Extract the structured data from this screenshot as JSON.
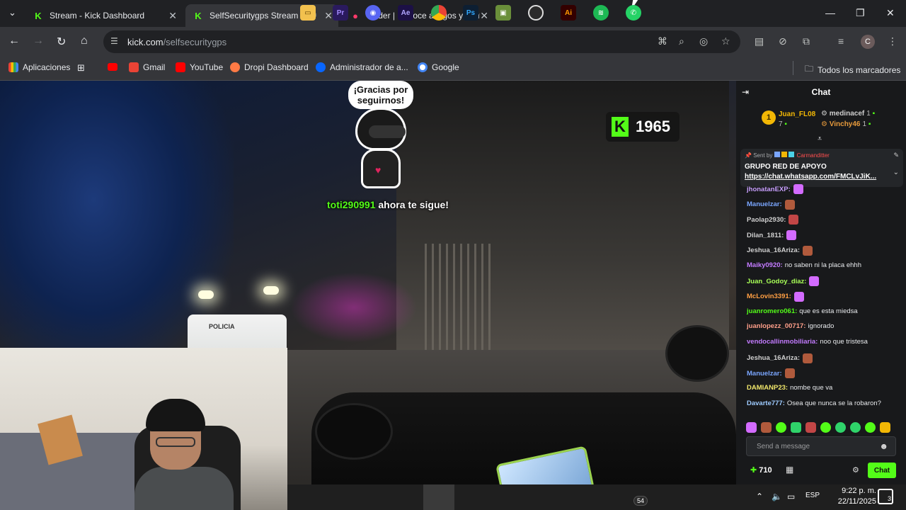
{
  "tabs": [
    {
      "title": "Stream - Kick Dashboard",
      "icon": "kick-icon"
    },
    {
      "title": "SelfSecuritygps Stream - W",
      "icon": "kick-icon",
      "audio": true
    },
    {
      "title": "Tinder | Conoce amigos y gente",
      "icon": "tinder-icon"
    }
  ],
  "address": {
    "host": "kick.com",
    "path": "/selfsecuritygps"
  },
  "bookmarks": [
    "Aplicaciones",
    "Gmail",
    "YouTube",
    "Dropi Dashboard",
    "Administrador de a...",
    "Google"
  ],
  "bookmarks_all": "Todos los marcadores",
  "overlay": {
    "bubble": "¡Gracias por seguirnos!",
    "follower": "toti290991",
    "follow_text": "ahora te sigue!",
    "viewer_count": "1965",
    "van_label": "POLICIA"
  },
  "chat": {
    "title": "Chat",
    "leaderboard": [
      {
        "name": "Juan_FL08",
        "count": "7",
        "color": "#f2b705"
      },
      {
        "name": "medinacef",
        "count": "1",
        "color": "#cfcfcf"
      },
      {
        "name": "Vinchy46",
        "count": "1",
        "color": "#e89b3c"
      }
    ],
    "pinned": {
      "sent_by": "Sent by",
      "sender": "Carmanditter",
      "title": "GRUPO RED DE APOYO",
      "link": "https://chat.whatsapp.com/FMCLvJiK..."
    },
    "messages": [
      {
        "user": "jhonatanEXP:",
        "text": "",
        "color": "#c9a0ff"
      },
      {
        "user": "Manuelzar:",
        "text": "",
        "color": "#7aa6ff"
      },
      {
        "user": "Paolap2930:",
        "text": "",
        "color": "#cfcfcf"
      },
      {
        "user": "Dilan_1811:",
        "text": "",
        "color": "#cfcfcf"
      },
      {
        "user": "Jeshua_16Ariza:",
        "text": "",
        "color": "#cfcfcf"
      },
      {
        "user": "Maiky0920:",
        "text": "no saben ni la placa ehhh",
        "color": "#c37bff"
      },
      {
        "user": "Juan_Godoy_diaz:",
        "text": "",
        "color": "#a8ff57"
      },
      {
        "user": "McLovin3391:",
        "text": "",
        "color": "#ff9f43"
      },
      {
        "user": "juanromero061:",
        "text": "que es esta miedsa",
        "color": "#53fc18"
      },
      {
        "user": "juanlopezz_00717:",
        "text": "ignorado",
        "color": "#ff9f8a"
      },
      {
        "user": "vendocallinmobiliaria:",
        "text": "noo que tristesa",
        "color": "#c37bff"
      },
      {
        "user": "Jeshua_16Ariza:",
        "text": "",
        "color": "#cfcfcf"
      },
      {
        "user": "Manuelzar:",
        "text": "",
        "color": "#7aa6ff"
      },
      {
        "user": "DAMIANP23:",
        "text": "nombe que va",
        "color": "#f2e86b"
      },
      {
        "user": "Davarte777:",
        "text": "Osea que nunca se la robaron?",
        "color": "#9ecbff"
      }
    ],
    "placeholder": "Send a message",
    "points": "710",
    "send_label": "Chat"
  },
  "taskbar": {
    "apps": [
      "File Explorer",
      "Premiere Pro",
      "Discord",
      "After Effects",
      "Chrome",
      "Photoshop",
      "Minecraft",
      "OBS",
      "Illustrator",
      "Spotify",
      "WhatsApp"
    ],
    "whatsapp_badge": "54",
    "lang": "ESP",
    "time": "9:22 p. m.",
    "date": "22/11/2025",
    "notifications": "3"
  },
  "colors": {
    "kick_green": "#53fc18",
    "chrome_bg": "#202124",
    "chat_bg": "#18191b"
  }
}
